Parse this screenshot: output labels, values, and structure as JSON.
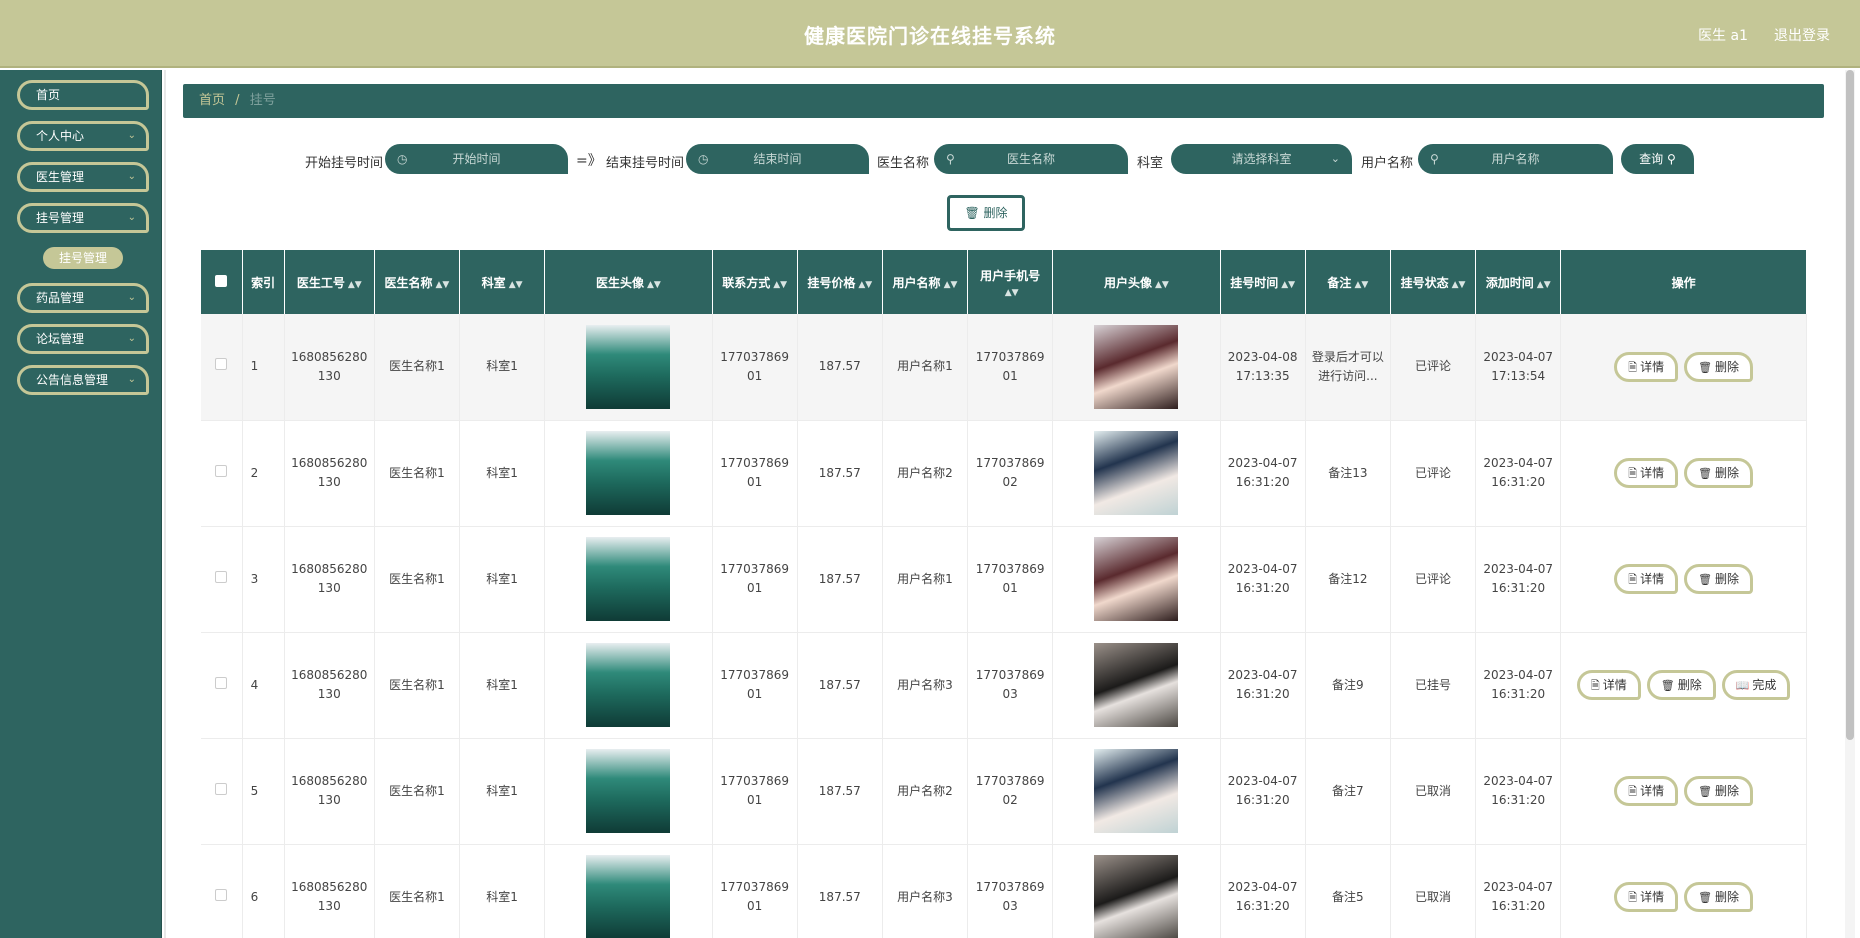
{
  "header": {
    "title": "健康医院门诊在线挂号系统",
    "user": "医生 a1",
    "logout": "退出登录"
  },
  "sidebar": {
    "items": [
      {
        "label": "首页",
        "has_chevron": false
      },
      {
        "label": "个人中心",
        "has_chevron": true
      },
      {
        "label": "医生管理",
        "has_chevron": true
      },
      {
        "label": "挂号管理",
        "has_chevron": true
      },
      {
        "label": "药品管理",
        "has_chevron": true
      },
      {
        "label": "论坛管理",
        "has_chevron": true
      },
      {
        "label": "公告信息管理",
        "has_chevron": true
      }
    ],
    "sub_item": "挂号管理"
  },
  "breadcrumb": {
    "home": "首页",
    "sep": "/",
    "current": "挂号"
  },
  "search": {
    "start_label": "开始挂号时间",
    "start_placeholder": "开始时间",
    "range_sep": "=》",
    "end_label": "结束挂号时间",
    "end_placeholder": "结束时间",
    "doctor_label": "医生名称",
    "doctor_placeholder": "医生名称",
    "dept_label": "科室",
    "dept_placeholder": "请选择科室",
    "user_label": "用户名称",
    "user_placeholder": "用户名称",
    "query_button": "查询"
  },
  "toolbar": {
    "delete_button": "删除"
  },
  "table": {
    "headers": [
      "索引",
      "医生工号",
      "医生名称",
      "科室",
      "医生头像",
      "联系方式",
      "挂号价格",
      "用户名称",
      "用户手机号",
      "用户头像",
      "挂号时间",
      "备注",
      "挂号状态",
      "添加时间",
      "操作"
    ],
    "action_labels": {
      "detail": "详情",
      "delete": "删除",
      "complete": "完成"
    },
    "rows": [
      {
        "index": "1",
        "doctor_no": "1680856280130",
        "doctor_name": "医生名称1",
        "dept": "科室1",
        "phone": "17703786901",
        "price": "187.57",
        "user_name": "用户名称1",
        "user_phone": "17703786901",
        "user_avatar": "user-ava-1",
        "reg_time": "2023-04-08 17:13:35",
        "note": "登录后才可以进行访问...",
        "status": "已评论",
        "add_time": "2023-04-07 17:13:54",
        "complete": false
      },
      {
        "index": "2",
        "doctor_no": "1680856280130",
        "doctor_name": "医生名称1",
        "dept": "科室1",
        "phone": "17703786901",
        "price": "187.57",
        "user_name": "用户名称2",
        "user_phone": "17703786902",
        "user_avatar": "user-ava-2",
        "reg_time": "2023-04-07 16:31:20",
        "note": "备注13",
        "status": "已评论",
        "add_time": "2023-04-07 16:31:20",
        "complete": false
      },
      {
        "index": "3",
        "doctor_no": "1680856280130",
        "doctor_name": "医生名称1",
        "dept": "科室1",
        "phone": "17703786901",
        "price": "187.57",
        "user_name": "用户名称1",
        "user_phone": "17703786901",
        "user_avatar": "user-ava-1",
        "reg_time": "2023-04-07 16:31:20",
        "note": "备注12",
        "status": "已评论",
        "add_time": "2023-04-07 16:31:20",
        "complete": false
      },
      {
        "index": "4",
        "doctor_no": "1680856280130",
        "doctor_name": "医生名称1",
        "dept": "科室1",
        "phone": "17703786901",
        "price": "187.57",
        "user_name": "用户名称3",
        "user_phone": "17703786903",
        "user_avatar": "user-ava-3",
        "reg_time": "2023-04-07 16:31:20",
        "note": "备注9",
        "status": "已挂号",
        "add_time": "2023-04-07 16:31:20",
        "complete": true
      },
      {
        "index": "5",
        "doctor_no": "1680856280130",
        "doctor_name": "医生名称1",
        "dept": "科室1",
        "phone": "17703786901",
        "price": "187.57",
        "user_name": "用户名称2",
        "user_phone": "17703786902",
        "user_avatar": "user-ava-2",
        "reg_time": "2023-04-07 16:31:20",
        "note": "备注7",
        "status": "已取消",
        "add_time": "2023-04-07 16:31:20",
        "complete": false
      },
      {
        "index": "6",
        "doctor_no": "1680856280130",
        "doctor_name": "医生名称1",
        "dept": "科室1",
        "phone": "17703786901",
        "price": "187.57",
        "user_name": "用户名称3",
        "user_phone": "17703786903",
        "user_avatar": "user-ava-3",
        "reg_time": "2023-04-07 16:31:20",
        "note": "备注5",
        "status": "已取消",
        "add_time": "2023-04-07 16:31:20",
        "complete": false
      }
    ]
  },
  "colors": {
    "primary": "#2e6460",
    "accent": "#c5c797"
  }
}
